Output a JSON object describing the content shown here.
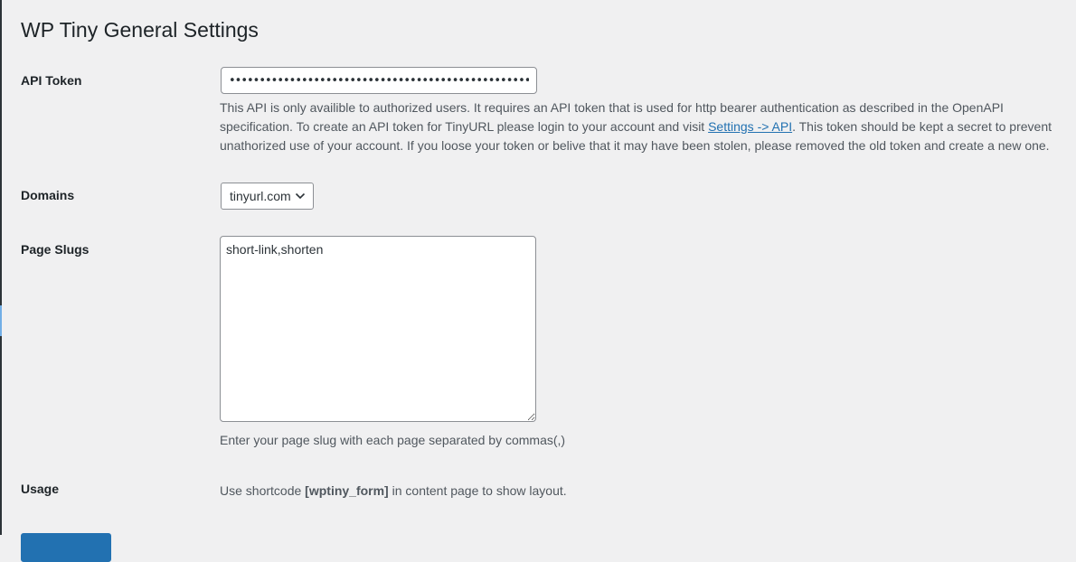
{
  "page": {
    "title": "WP Tiny General Settings"
  },
  "api_token": {
    "label": "API Token",
    "value": "••••••••••••••••••••••••••••••••••••••••••••••••••••••••••",
    "description_part1": "This API is only availible to authorized users. It requires an API token that is used for http bearer authentication as described in the OpenAPI specification. To create an API token for TinyURL please login to your account and visit ",
    "link_text": "Settings -> API",
    "description_part2": ". This token should be kept a secret to prevent unathorized use of your account. If you loose your token or belive that it may have been stolen, please removed the old token and create a new one."
  },
  "domains": {
    "label": "Domains",
    "selected": "tinyurl.com",
    "icon": "chevron-down-icon"
  },
  "page_slugs": {
    "label": "Page Slugs",
    "value": "short-link,shorten",
    "description": "Enter your page slug with each page separated by commas(,)"
  },
  "usage": {
    "label": "Usage",
    "prefix": "Use shortcode ",
    "shortcode": "[wptiny_form]",
    "suffix": " in content page to show layout."
  },
  "colors": {
    "background": "#f0f0f1",
    "link": "#2271b1",
    "primary_button": "#2271b1"
  }
}
